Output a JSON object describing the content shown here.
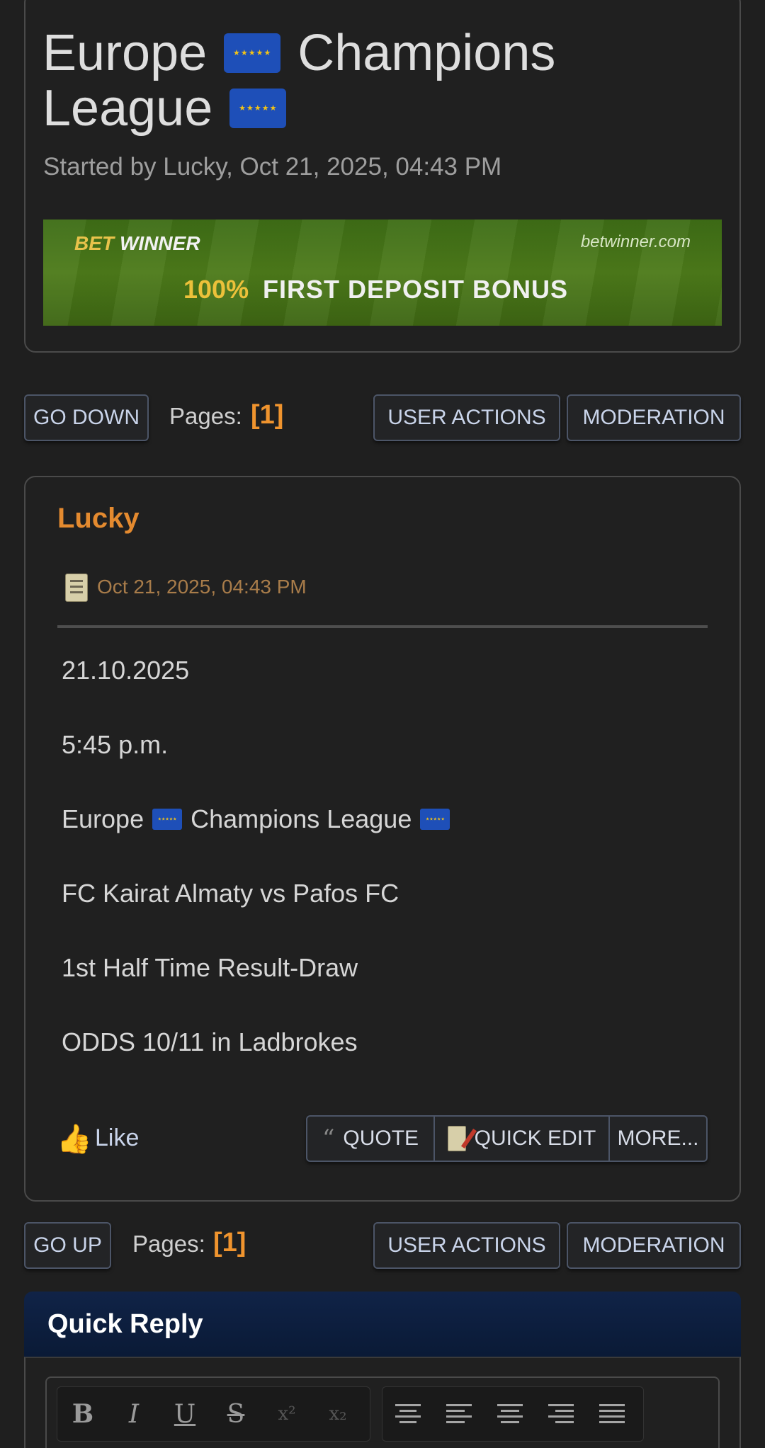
{
  "topic": {
    "title_part1": "Europe",
    "title_part2": "Champions",
    "title_part3": "League",
    "started_by": "Started by Lucky, Oct 21, 2025, 04:43 PM",
    "flag_icon": "eu-flag-icon"
  },
  "banner": {
    "brand_a": "BET",
    "brand_b": "WINNER",
    "site": "betwinner.com",
    "percent": "100%",
    "offer": "FIRST DEPOSIT BONUS"
  },
  "nav_top": {
    "go_label": "GO DOWN",
    "pages_label": "Pages:",
    "pages_value": "[1]",
    "user_actions": "USER ACTIONS",
    "moderation": "MODERATION"
  },
  "post": {
    "author": "Lucky",
    "date": "Oct 21, 2025, 04:43 PM",
    "lines": [
      "21.10.2025",
      "5:45 p.m.",
      "Europe",
      "Champions League",
      "FC Kairat Almaty vs Pafos FC",
      "1st Half Time Result-Draw",
      "ODDS 10/11 in Ladbrokes"
    ],
    "like_label": "Like",
    "quote_label": "QUOTE",
    "quick_edit_label": "QUICK EDIT",
    "more_label": "MORE..."
  },
  "nav_bottom": {
    "go_label": "GO UP",
    "pages_label": "Pages:",
    "pages_value": "[1]",
    "user_actions": "USER ACTIONS",
    "moderation": "MODERATION"
  },
  "quick_reply": {
    "title": "Quick Reply",
    "toolbar_format": [
      "B",
      "I",
      "U",
      "S",
      "x²",
      "x₂"
    ]
  },
  "colors": {
    "background": "#1f1f1f",
    "accent_orange": "#f0942e",
    "author_orange": "#e48a2f",
    "button_text": "#c9d4ea",
    "quick_reply_header": "#0a1a36"
  }
}
